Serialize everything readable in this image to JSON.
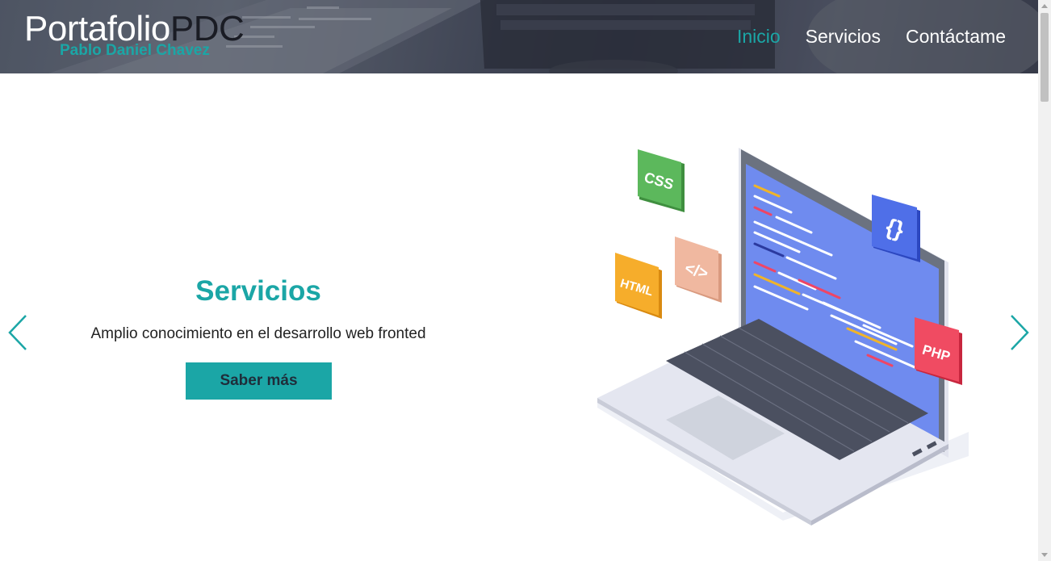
{
  "header": {
    "logo_part1": "Portafolio",
    "logo_part2": "PDC",
    "subtitle": "Pablo Daniel Chavez"
  },
  "nav": {
    "items": [
      {
        "label": "Inicio",
        "active": true
      },
      {
        "label": "Servicios",
        "active": false
      },
      {
        "label": "Contáctame",
        "active": false
      }
    ]
  },
  "slide": {
    "title": "Servicios",
    "description": "Amplio conocimiento en el desarrollo web fronted",
    "button_label": "Saber más"
  },
  "illustration": {
    "badges": [
      "CSS",
      "</>",
      "HTML",
      "{}",
      "PHP"
    ]
  },
  "colors": {
    "accent": "#1ba6a6",
    "text_dark": "#222222"
  }
}
